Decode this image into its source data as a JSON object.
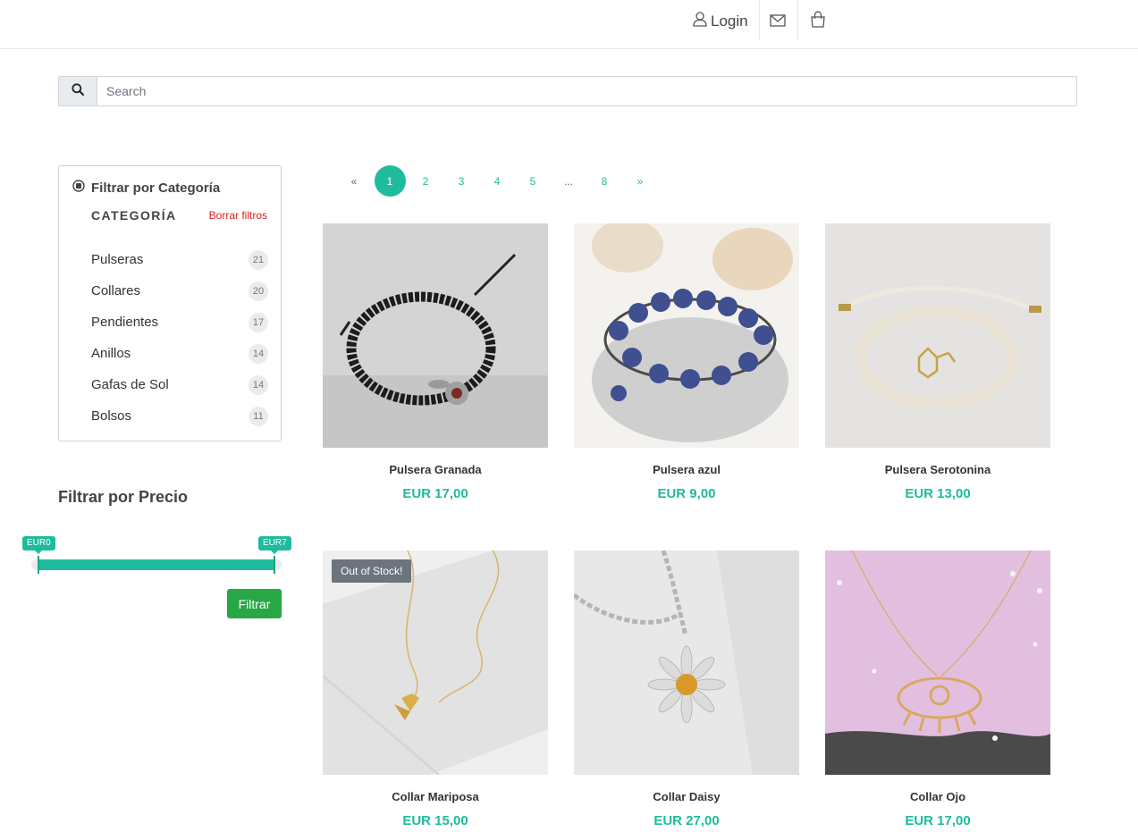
{
  "header": {
    "login_label": "Login",
    "user_icon": "user-icon",
    "mail_icon": "mail-icon",
    "cart_icon": "shopping-bag-icon"
  },
  "search": {
    "placeholder": "Search",
    "value": "",
    "icon": "search-icon"
  },
  "category_filter": {
    "title": "Filtrar por Categoría",
    "heading": "CATEGORÍA",
    "clear_label": "Borrar filtros",
    "items": [
      {
        "label": "Pulseras",
        "count": "21"
      },
      {
        "label": "Collares",
        "count": "20"
      },
      {
        "label": "Pendientes",
        "count": "17"
      },
      {
        "label": "Anillos",
        "count": "14"
      },
      {
        "label": "Gafas de Sol",
        "count": "14"
      },
      {
        "label": "Bolsos",
        "count": "11"
      }
    ]
  },
  "price_filter": {
    "title": "Filtrar por Precio",
    "min_label": "EUR0",
    "max_label": "EUR7",
    "button_label": "Filtrar"
  },
  "pagination": {
    "prev": "«",
    "pages": [
      "1",
      "2",
      "3",
      "4",
      "5"
    ],
    "ellipsis": "...",
    "last": "8",
    "next": "»",
    "active": "1"
  },
  "products": [
    {
      "name": "Pulsera Granada",
      "price": "EUR 17,00",
      "badge": ""
    },
    {
      "name": "Pulsera azul",
      "price": "EUR 9,00",
      "badge": ""
    },
    {
      "name": "Pulsera Serotonina",
      "price": "EUR 13,00",
      "badge": ""
    },
    {
      "name": "Collar Mariposa",
      "price": "EUR 15,00",
      "badge": "Out of Stock!"
    },
    {
      "name": "Collar Daisy",
      "price": "EUR 27,00",
      "badge": ""
    },
    {
      "name": "Collar Ojo",
      "price": "EUR 17,00",
      "badge": ""
    }
  ],
  "colors": {
    "accent": "#1ebc9c",
    "filter_button": "#28a745",
    "clear_link": "#dd1c1c",
    "badge": "#6c757d"
  }
}
